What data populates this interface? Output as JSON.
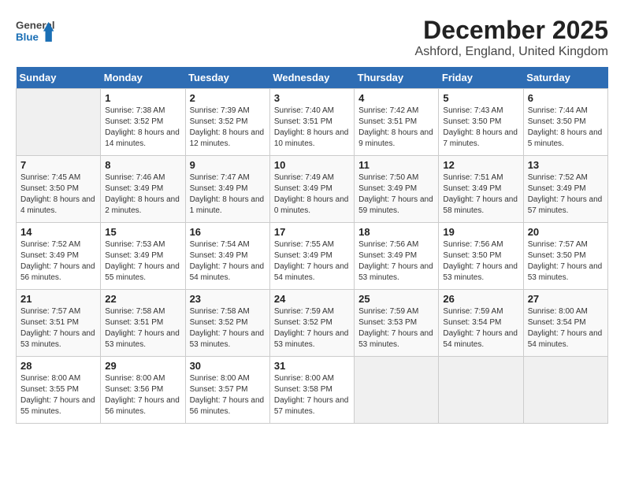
{
  "header": {
    "logo_general": "General",
    "logo_blue": "Blue",
    "title": "December 2025",
    "location": "Ashford, England, United Kingdom"
  },
  "days_of_week": [
    "Sunday",
    "Monday",
    "Tuesday",
    "Wednesday",
    "Thursday",
    "Friday",
    "Saturday"
  ],
  "weeks": [
    [
      {
        "day": "",
        "content": ""
      },
      {
        "day": "1",
        "sunrise": "Sunrise: 7:38 AM",
        "sunset": "Sunset: 3:52 PM",
        "daylight": "Daylight: 8 hours and 14 minutes."
      },
      {
        "day": "2",
        "sunrise": "Sunrise: 7:39 AM",
        "sunset": "Sunset: 3:52 PM",
        "daylight": "Daylight: 8 hours and 12 minutes."
      },
      {
        "day": "3",
        "sunrise": "Sunrise: 7:40 AM",
        "sunset": "Sunset: 3:51 PM",
        "daylight": "Daylight: 8 hours and 10 minutes."
      },
      {
        "day": "4",
        "sunrise": "Sunrise: 7:42 AM",
        "sunset": "Sunset: 3:51 PM",
        "daylight": "Daylight: 8 hours and 9 minutes."
      },
      {
        "day": "5",
        "sunrise": "Sunrise: 7:43 AM",
        "sunset": "Sunset: 3:50 PM",
        "daylight": "Daylight: 8 hours and 7 minutes."
      },
      {
        "day": "6",
        "sunrise": "Sunrise: 7:44 AM",
        "sunset": "Sunset: 3:50 PM",
        "daylight": "Daylight: 8 hours and 5 minutes."
      }
    ],
    [
      {
        "day": "7",
        "sunrise": "Sunrise: 7:45 AM",
        "sunset": "Sunset: 3:50 PM",
        "daylight": "Daylight: 8 hours and 4 minutes."
      },
      {
        "day": "8",
        "sunrise": "Sunrise: 7:46 AM",
        "sunset": "Sunset: 3:49 PM",
        "daylight": "Daylight: 8 hours and 2 minutes."
      },
      {
        "day": "9",
        "sunrise": "Sunrise: 7:47 AM",
        "sunset": "Sunset: 3:49 PM",
        "daylight": "Daylight: 8 hours and 1 minute."
      },
      {
        "day": "10",
        "sunrise": "Sunrise: 7:49 AM",
        "sunset": "Sunset: 3:49 PM",
        "daylight": "Daylight: 8 hours and 0 minutes."
      },
      {
        "day": "11",
        "sunrise": "Sunrise: 7:50 AM",
        "sunset": "Sunset: 3:49 PM",
        "daylight": "Daylight: 7 hours and 59 minutes."
      },
      {
        "day": "12",
        "sunrise": "Sunrise: 7:51 AM",
        "sunset": "Sunset: 3:49 PM",
        "daylight": "Daylight: 7 hours and 58 minutes."
      },
      {
        "day": "13",
        "sunrise": "Sunrise: 7:52 AM",
        "sunset": "Sunset: 3:49 PM",
        "daylight": "Daylight: 7 hours and 57 minutes."
      }
    ],
    [
      {
        "day": "14",
        "sunrise": "Sunrise: 7:52 AM",
        "sunset": "Sunset: 3:49 PM",
        "daylight": "Daylight: 7 hours and 56 minutes."
      },
      {
        "day": "15",
        "sunrise": "Sunrise: 7:53 AM",
        "sunset": "Sunset: 3:49 PM",
        "daylight": "Daylight: 7 hours and 55 minutes."
      },
      {
        "day": "16",
        "sunrise": "Sunrise: 7:54 AM",
        "sunset": "Sunset: 3:49 PM",
        "daylight": "Daylight: 7 hours and 54 minutes."
      },
      {
        "day": "17",
        "sunrise": "Sunrise: 7:55 AM",
        "sunset": "Sunset: 3:49 PM",
        "daylight": "Daylight: 7 hours and 54 minutes."
      },
      {
        "day": "18",
        "sunrise": "Sunrise: 7:56 AM",
        "sunset": "Sunset: 3:49 PM",
        "daylight": "Daylight: 7 hours and 53 minutes."
      },
      {
        "day": "19",
        "sunrise": "Sunrise: 7:56 AM",
        "sunset": "Sunset: 3:50 PM",
        "daylight": "Daylight: 7 hours and 53 minutes."
      },
      {
        "day": "20",
        "sunrise": "Sunrise: 7:57 AM",
        "sunset": "Sunset: 3:50 PM",
        "daylight": "Daylight: 7 hours and 53 minutes."
      }
    ],
    [
      {
        "day": "21",
        "sunrise": "Sunrise: 7:57 AM",
        "sunset": "Sunset: 3:51 PM",
        "daylight": "Daylight: 7 hours and 53 minutes."
      },
      {
        "day": "22",
        "sunrise": "Sunrise: 7:58 AM",
        "sunset": "Sunset: 3:51 PM",
        "daylight": "Daylight: 7 hours and 53 minutes."
      },
      {
        "day": "23",
        "sunrise": "Sunrise: 7:58 AM",
        "sunset": "Sunset: 3:52 PM",
        "daylight": "Daylight: 7 hours and 53 minutes."
      },
      {
        "day": "24",
        "sunrise": "Sunrise: 7:59 AM",
        "sunset": "Sunset: 3:52 PM",
        "daylight": "Daylight: 7 hours and 53 minutes."
      },
      {
        "day": "25",
        "sunrise": "Sunrise: 7:59 AM",
        "sunset": "Sunset: 3:53 PM",
        "daylight": "Daylight: 7 hours and 53 minutes."
      },
      {
        "day": "26",
        "sunrise": "Sunrise: 7:59 AM",
        "sunset": "Sunset: 3:54 PM",
        "daylight": "Daylight: 7 hours and 54 minutes."
      },
      {
        "day": "27",
        "sunrise": "Sunrise: 8:00 AM",
        "sunset": "Sunset: 3:54 PM",
        "daylight": "Daylight: 7 hours and 54 minutes."
      }
    ],
    [
      {
        "day": "28",
        "sunrise": "Sunrise: 8:00 AM",
        "sunset": "Sunset: 3:55 PM",
        "daylight": "Daylight: 7 hours and 55 minutes."
      },
      {
        "day": "29",
        "sunrise": "Sunrise: 8:00 AM",
        "sunset": "Sunset: 3:56 PM",
        "daylight": "Daylight: 7 hours and 56 minutes."
      },
      {
        "day": "30",
        "sunrise": "Sunrise: 8:00 AM",
        "sunset": "Sunset: 3:57 PM",
        "daylight": "Daylight: 7 hours and 56 minutes."
      },
      {
        "day": "31",
        "sunrise": "Sunrise: 8:00 AM",
        "sunset": "Sunset: 3:58 PM",
        "daylight": "Daylight: 7 hours and 57 minutes."
      },
      {
        "day": "",
        "content": ""
      },
      {
        "day": "",
        "content": ""
      },
      {
        "day": "",
        "content": ""
      }
    ]
  ]
}
